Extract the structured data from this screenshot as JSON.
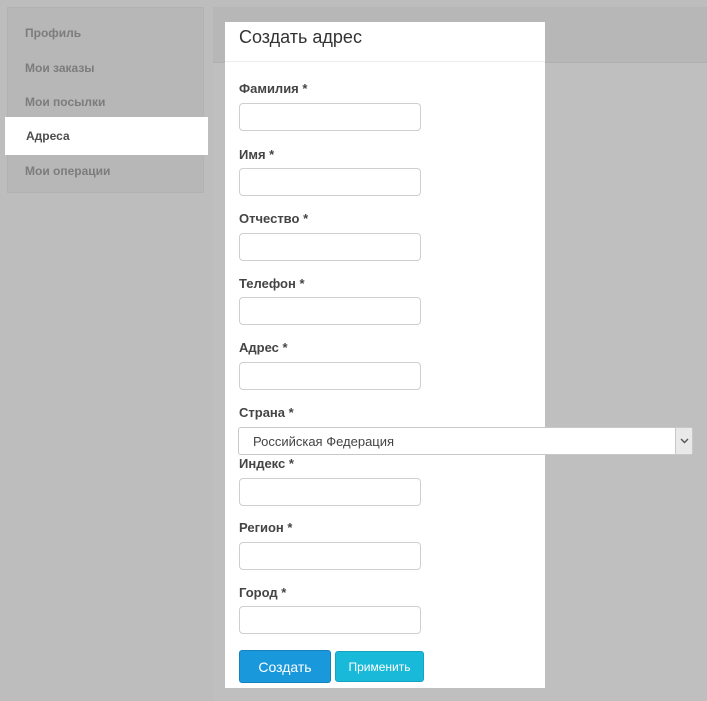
{
  "sidebar": {
    "items": [
      {
        "label": "Профиль"
      },
      {
        "label": "Мои заказы"
      },
      {
        "label": "Мои посылки"
      },
      {
        "label": "Адреса"
      },
      {
        "label": "Мои операции"
      }
    ],
    "active_index": 3
  },
  "modal": {
    "title": "Создать адрес",
    "fields": {
      "last_name": {
        "label": "Фамилия",
        "required": "*",
        "value": ""
      },
      "first_name": {
        "label": "Имя",
        "required": "*",
        "value": ""
      },
      "patronymic": {
        "label": "Отчество",
        "required": "*",
        "value": ""
      },
      "phone": {
        "label": "Телефон",
        "required": "*",
        "value": ""
      },
      "address": {
        "label": "Адрес",
        "required": "*",
        "value": ""
      },
      "country": {
        "label": "Страна",
        "required": "*",
        "selected": "Российская Федерация"
      },
      "postal_code": {
        "label": "Индекс",
        "required": "*",
        "value": ""
      },
      "region": {
        "label": "Регион",
        "required": "*",
        "value": ""
      },
      "city": {
        "label": "Город",
        "required": "*",
        "value": ""
      }
    },
    "buttons": {
      "create_label": "Создать",
      "apply_label": "Применить"
    }
  },
  "colors": {
    "overlay_background": "#bdbdbd",
    "create_button": "#1a98dc",
    "apply_button": "#19b9d9"
  },
  "icons": {
    "select_arrow": "chevron-down-icon"
  }
}
